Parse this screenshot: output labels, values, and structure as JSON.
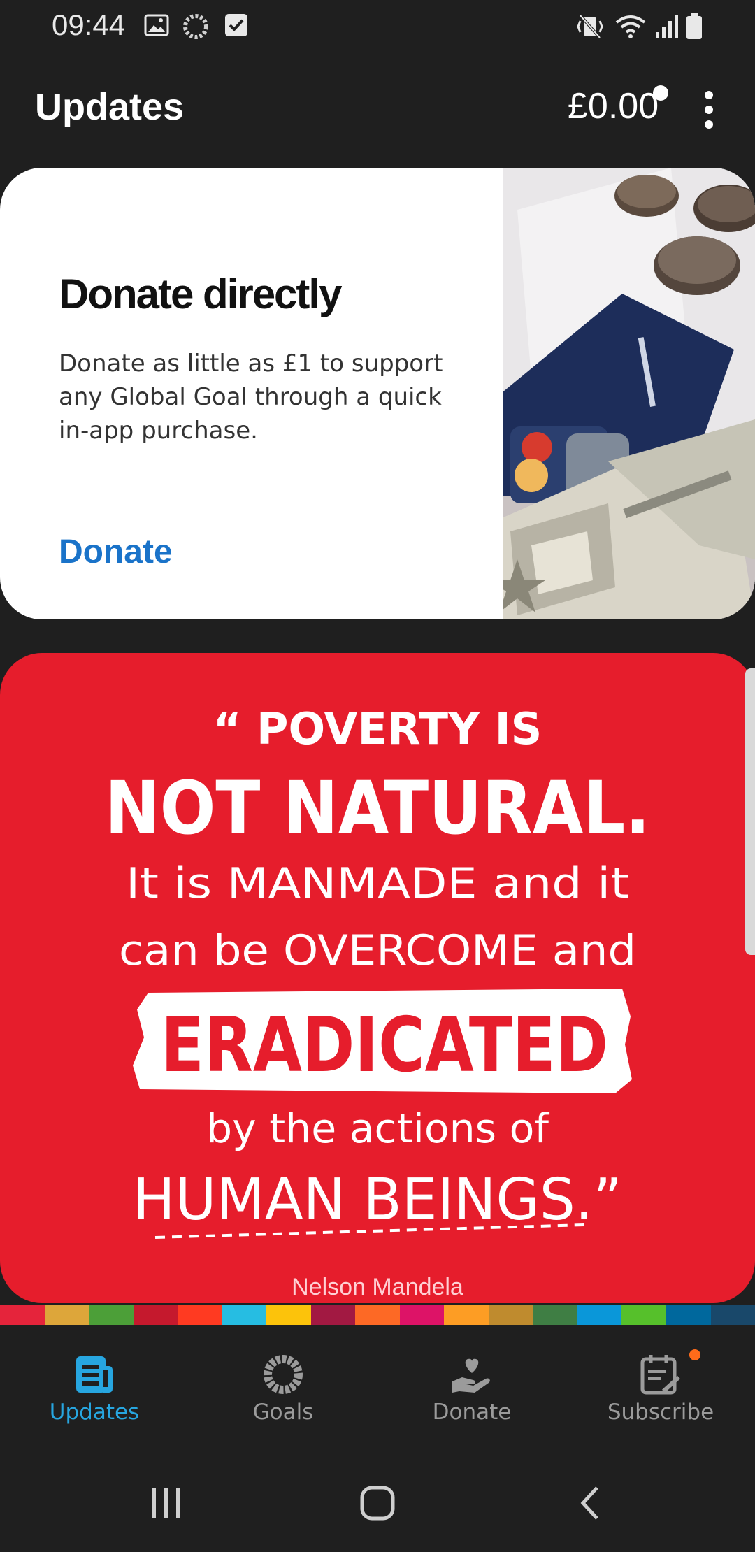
{
  "status_bar": {
    "time": "09:44",
    "left_icons": [
      "image-icon",
      "sync-ring-icon",
      "checkbox-icon"
    ],
    "right_icons": [
      "vibrate-icon",
      "wifi-icon",
      "signal-icon",
      "battery-icon"
    ]
  },
  "app_bar": {
    "title": "Updates",
    "balance": "£0.00",
    "menu_icon": "more-vertical-icon"
  },
  "donate_card": {
    "heading": "Donate directly",
    "description": "Donate as little as £1 to support any Global Goal through a quick in-app purchase.",
    "action_label": "Donate",
    "image_icon": "money-cards-photo"
  },
  "quote_card": {
    "lines": [
      "“ POVERTY IS",
      "NOT NATURAL.",
      "It is MANMADE and it",
      "can be OVERCOME and",
      "ERADICATED",
      "by the actions of",
      "HUMAN BEINGS.”"
    ],
    "author": "Nelson Mandela",
    "background": "#e61d2c"
  },
  "sdg_colors": [
    "#e5243b",
    "#dda63a",
    "#4c9f38",
    "#c5192d",
    "#ff3a21",
    "#26bde2",
    "#fcc30b",
    "#a21942",
    "#fd6925",
    "#dd1367",
    "#fd9d24",
    "#bf8b2e",
    "#3f7e44",
    "#0a97d9",
    "#56c02b",
    "#00689d",
    "#19486a"
  ],
  "bottom_nav": {
    "items": [
      {
        "label": "Updates",
        "icon": "news-icon",
        "active": true
      },
      {
        "label": "Goals",
        "icon": "goals-ring-icon",
        "active": false
      },
      {
        "label": "Donate",
        "icon": "heart-hand-icon",
        "active": false
      },
      {
        "label": "Subscribe",
        "icon": "calendar-edit-icon",
        "active": false,
        "badge": true
      }
    ],
    "active_color": "#27a6e0",
    "inactive_color": "#9b9b9b"
  },
  "system_nav": {
    "buttons": [
      "recents-icon",
      "home-icon",
      "back-icon"
    ]
  }
}
